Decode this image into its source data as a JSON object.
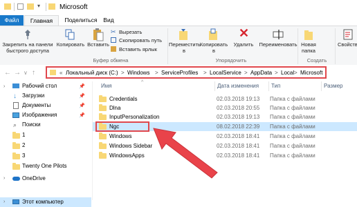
{
  "window": {
    "title": "Microsoft"
  },
  "tabs": [
    "Файл",
    "Главная",
    "Поделиться",
    "Вид"
  ],
  "ribbon": {
    "pin_label": "Закрепить на панели быстрого доступа",
    "copy_label": "Копировать",
    "paste_label": "Вставить",
    "cut_label": "Вырезать",
    "copy_path_label": "Скопировать путь",
    "paste_shortcut_label": "Вставить ярлык",
    "clipboard_group": "Буфер обмена",
    "move_to_label": "Переместить в",
    "copy_to_label": "Копировать в",
    "delete_label": "Удалить",
    "rename_label": "Переименовать",
    "organize_group": "Упорядочить",
    "new_folder_label": "Новая папка",
    "create_group": "Создать",
    "properties_label": "Свойства"
  },
  "address": {
    "prefix": "«",
    "crumbs": [
      "Локальный диск (C:)",
      "Windows",
      "ServiceProfiles",
      "LocalService",
      "AppData",
      "Local",
      "Microsoft"
    ],
    "separator": ">"
  },
  "sidebar": {
    "items": [
      {
        "label": "Рабочий стол",
        "icon": "desktop-icon",
        "pinned": true
      },
      {
        "label": "Загрузки",
        "icon": "downloads-icon",
        "pinned": true
      },
      {
        "label": "Документы",
        "icon": "documents-icon",
        "pinned": true
      },
      {
        "label": "Изображения",
        "icon": "pictures-icon",
        "pinned": true
      },
      {
        "label": "Поиски",
        "icon": "search-icon",
        "pinned": false
      },
      {
        "label": "1",
        "icon": "folder-icon",
        "pinned": false
      },
      {
        "label": "2",
        "icon": "folder-icon",
        "pinned": false
      },
      {
        "label": "3",
        "icon": "folder-icon",
        "pinned": false
      },
      {
        "label": "Twenty One Pilots",
        "icon": "folder-icon",
        "pinned": false
      },
      {
        "label": "OneDrive",
        "icon": "onedrive-icon",
        "pinned": false
      },
      {
        "label": "Этот компьютер",
        "icon": "computer-icon",
        "pinned": false
      }
    ]
  },
  "file_list": {
    "columns": [
      "Имя",
      "Дата изменения",
      "Тип",
      "Размер"
    ],
    "rows": [
      {
        "name": "Credentials",
        "date": "02.03.2018 19:13",
        "type": "Папка с файлами"
      },
      {
        "name": "Dlna",
        "date": "02.03.2018 20:55",
        "type": "Папка с файлами"
      },
      {
        "name": "InputPersonalization",
        "date": "02.03.2018 19:13",
        "type": "Папка с файлами"
      },
      {
        "name": "Ngc",
        "date": "08.02.2018 22:39",
        "type": "Папка с файлами"
      },
      {
        "name": "Windows",
        "date": "02.03.2018 18:41",
        "type": "Папка с файлами"
      },
      {
        "name": "Windows Sidebar",
        "date": "02.03.2018 18:41",
        "type": "Папка с файлами"
      },
      {
        "name": "WindowsApps",
        "date": "02.03.2018 18:41",
        "type": "Папка с файлами"
      }
    ],
    "selected_row": 3
  },
  "colors": {
    "accent": "#1979ca",
    "highlight": "#e0474c",
    "selection": "#cce8ff",
    "folder": "#f8d775"
  }
}
